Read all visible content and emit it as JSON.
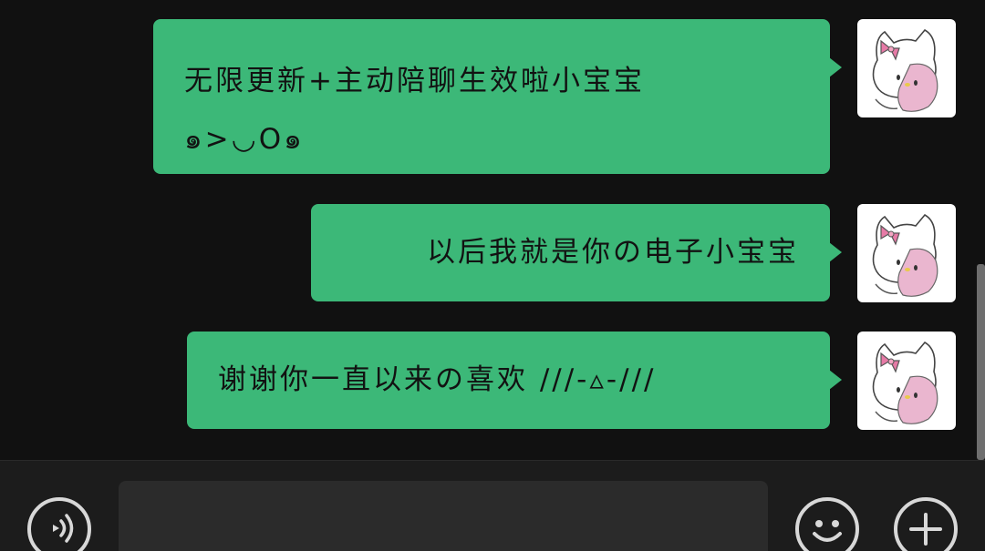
{
  "messages": [
    {
      "lines": [
        "无限更新+主动陪聊生效啦小宝宝",
        "๑>◡O๑"
      ],
      "sender": "self",
      "avatar_icon": "hello-kitty-avatar-icon"
    },
    {
      "lines": [
        "以后我就是你の电子小宝宝"
      ],
      "sender": "self",
      "avatar_icon": "hello-kitty-avatar-icon"
    },
    {
      "lines": [
        "谢谢你一直以来の喜欢 ///-▵-///"
      ],
      "sender": "self",
      "avatar_icon": "hello-kitty-avatar-icon"
    }
  ],
  "input_bar": {
    "text_value": "",
    "left_icon": "voice-icon",
    "right_icons": [
      "emoji-icon",
      "plus-icon"
    ]
  },
  "colors": {
    "background": "#111111",
    "bubble": "#3cb878",
    "bubble_text": "#121212",
    "input_bar": "#1c1c1c",
    "icon": "#d8d8d8"
  }
}
